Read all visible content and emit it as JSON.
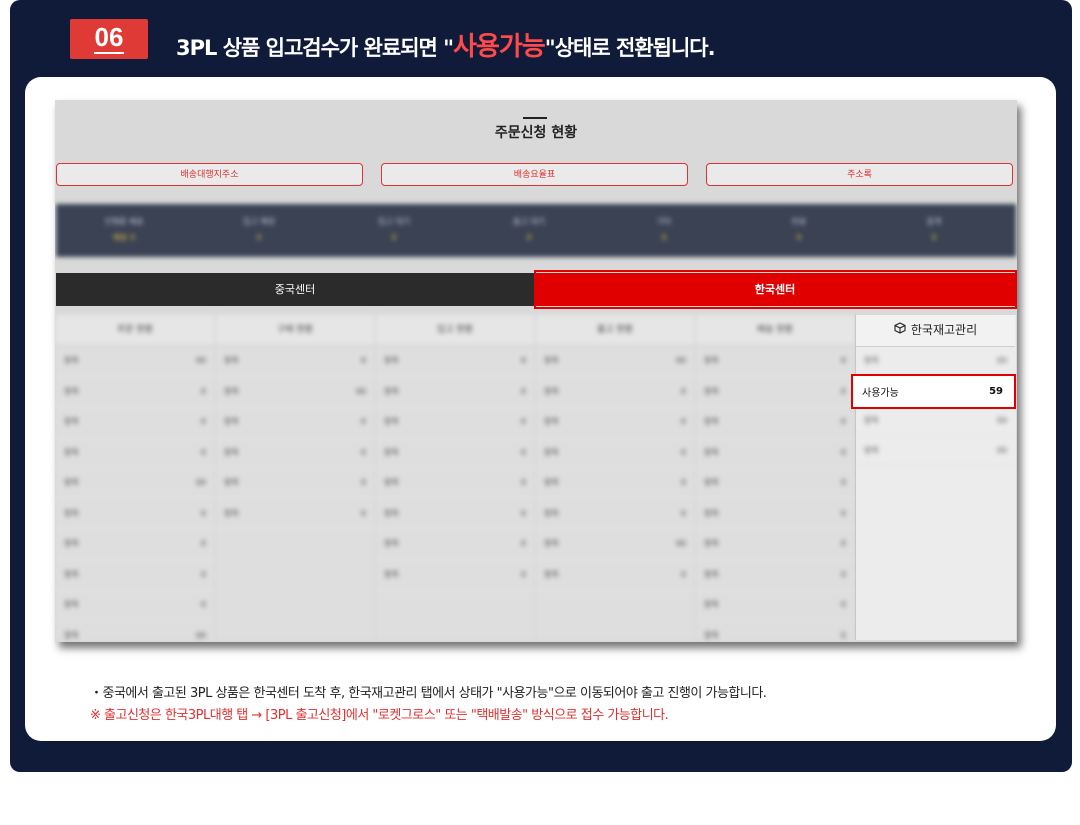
{
  "step": {
    "number": "06"
  },
  "headline": {
    "pre": "3PL 상품 입고검수가 완료되면 \"",
    "highlight": "사용가능",
    "post": "\"상태로 전환됩니다."
  },
  "screenshot": {
    "title": "주문신청 현황",
    "top_buttons": [
      "배송대행지주소",
      "배송요율표",
      "주소록"
    ],
    "stats": [
      {
        "label": "진행중 배송",
        "value": "배송 0"
      },
      {
        "label": "입고 예정",
        "value": "0"
      },
      {
        "label": "입고 대기",
        "value": "0"
      },
      {
        "label": "출고 대기",
        "value": "0"
      },
      {
        "label": "기타",
        "value": "0"
      },
      {
        "label": "반송",
        "value": "0"
      },
      {
        "label": "합계",
        "value": "0"
      }
    ],
    "tabs": {
      "china": "중국센터",
      "korea": "한국센터"
    },
    "columns": [
      {
        "title": "주문 현황",
        "rows": [
          [
            "항목",
            "00"
          ],
          [
            "항목",
            "0"
          ],
          [
            "항목",
            "0"
          ],
          [
            "항목",
            "0"
          ],
          [
            "항목",
            "00"
          ],
          [
            "항목",
            "0"
          ],
          [
            "항목",
            "0"
          ],
          [
            "항목",
            "0"
          ],
          [
            "항목",
            "0"
          ],
          [
            "항목",
            "00"
          ]
        ]
      },
      {
        "title": "구매 현황",
        "rows": [
          [
            "항목",
            "0"
          ],
          [
            "항목",
            "00"
          ],
          [
            "항목",
            "0"
          ],
          [
            "항목",
            "0"
          ],
          [
            "항목",
            "0"
          ],
          [
            "항목",
            "0"
          ]
        ]
      },
      {
        "title": "입고 현황",
        "rows": [
          [
            "항목",
            "0"
          ],
          [
            "항목",
            "0"
          ],
          [
            "항목",
            "0"
          ],
          [
            "항목",
            "0"
          ],
          [
            "항목",
            "0"
          ],
          [
            "항목",
            "0"
          ],
          [
            "항목",
            "0"
          ],
          [
            "항목",
            "0"
          ]
        ]
      },
      {
        "title": "출고 현황",
        "rows": [
          [
            "항목",
            "00"
          ],
          [
            "항목",
            "0"
          ],
          [
            "항목",
            "0"
          ],
          [
            "항목",
            "0"
          ],
          [
            "항목",
            "0"
          ],
          [
            "항목",
            "0"
          ],
          [
            "항목",
            "00"
          ],
          [
            "항목",
            "0"
          ]
        ]
      },
      {
        "title": "배송 현황",
        "rows": [
          [
            "항목",
            "0"
          ],
          [
            "항목",
            "0"
          ],
          [
            "항목",
            "0"
          ],
          [
            "항목",
            "0"
          ],
          [
            "항목",
            "0"
          ],
          [
            "항목",
            "0"
          ],
          [
            "항목",
            "0"
          ],
          [
            "항목",
            "0"
          ],
          [
            "항목",
            "0"
          ],
          [
            "항목",
            "0"
          ]
        ]
      }
    ],
    "sidebar": {
      "title": "한국재고관리",
      "rows_above": [
        [
          "항목",
          "00"
        ]
      ],
      "available": {
        "label": "사용가능",
        "count": "59"
      },
      "rows_below": [
        [
          "항목",
          "00"
        ],
        [
          "항목",
          "00"
        ]
      ]
    }
  },
  "notes": {
    "line1": "・중국에서 출고된 3PL 상품은 한국센터 도착 후, 한국재고관리 탭에서 상태가 \"사용가능\"으로 이동되어야 출고 진행이 가능합니다.",
    "line2": "※ 출고신청은 한국3PL대행 탭 → [3PL 출고신청]에서 \"로켓그로스\" 또는 \"택배발송\" 방식으로 접수 가능합니다."
  },
  "colors": {
    "navy": "#0f1b38",
    "accent_red": "#e03a36",
    "tab_red": "#e00000"
  }
}
